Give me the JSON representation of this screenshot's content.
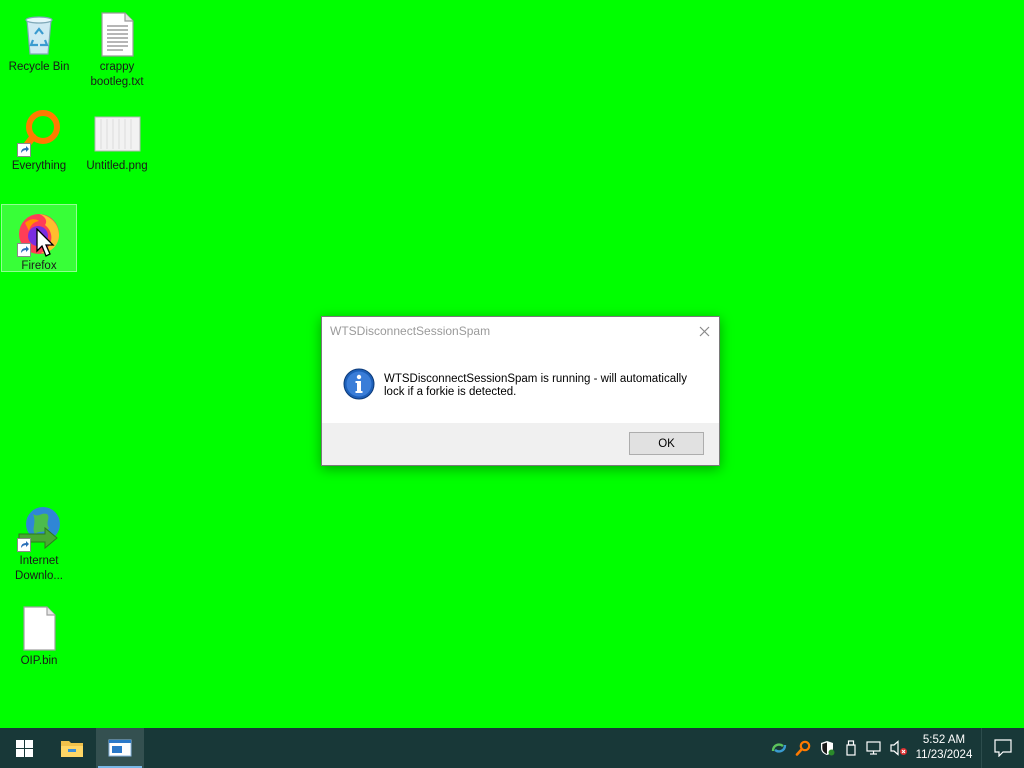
{
  "desktop": {
    "icons": [
      {
        "label": "Recycle Bin",
        "icon": "recycle-bin-icon"
      },
      {
        "label": "crappy bootleg.txt",
        "icon": "text-file-icon"
      },
      {
        "label": "Everything",
        "icon": "everything-search-icon"
      },
      {
        "label": "Untitled.png",
        "icon": "image-file-icon"
      },
      {
        "label": "Firefox",
        "icon": "firefox-icon"
      },
      {
        "label": "Internet Downlo...",
        "icon": "internet-download-manager-icon"
      },
      {
        "label": "OIP.bin",
        "icon": "blank-file-icon"
      }
    ],
    "background_color": "#00ff00"
  },
  "dialog": {
    "title": "WTSDisconnectSessionSpam",
    "message": "WTSDisconnectSessionSpam is running - will automatically lock if a forkie is detected.",
    "ok_label": "OK",
    "icon": "info-icon"
  },
  "taskbar": {
    "apps": [
      {
        "icon": "windows-start-icon"
      },
      {
        "icon": "file-explorer-icon"
      },
      {
        "icon": "dialog-window-app-icon"
      }
    ],
    "tray": [
      {
        "icon": "network-sync-icon"
      },
      {
        "icon": "everything-search-icon"
      },
      {
        "icon": "windows-security-icon"
      },
      {
        "icon": "usb-drive-icon"
      },
      {
        "icon": "network-icon"
      },
      {
        "icon": "volume-muted-icon"
      }
    ],
    "time": "5:52 AM",
    "date": "11/23/2024",
    "background_color": "#183838"
  }
}
